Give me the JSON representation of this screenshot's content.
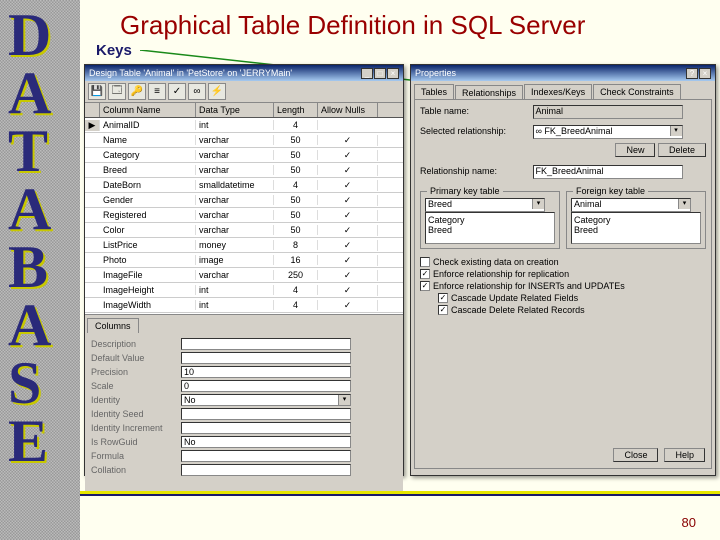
{
  "slide": {
    "title": "Graphical Table Definition in SQL Server",
    "keys_label": "Keys",
    "page_number": "80",
    "sidebar_letters": [
      "D",
      "A",
      "T",
      "A",
      "B",
      "A",
      "S",
      "E"
    ]
  },
  "design_window": {
    "title": "Design Table 'Animal' in 'PetStore' on 'JERRYMain'",
    "toolbar_icons": [
      "save-icon",
      "properties-icon",
      "key-icon",
      "index-icon",
      "check-icon",
      "relation-icon",
      "trigger-icon"
    ],
    "column_headers": [
      "",
      "Column Name",
      "Data Type",
      "Length",
      "Allow Nulls"
    ],
    "rows": [
      {
        "key": "▶",
        "name": "AnimalID",
        "type": "int",
        "len": "4",
        "nulls": ""
      },
      {
        "key": "",
        "name": "Name",
        "type": "varchar",
        "len": "50",
        "nulls": "✓"
      },
      {
        "key": "",
        "name": "Category",
        "type": "varchar",
        "len": "50",
        "nulls": "✓"
      },
      {
        "key": "",
        "name": "Breed",
        "type": "varchar",
        "len": "50",
        "nulls": "✓"
      },
      {
        "key": "",
        "name": "DateBorn",
        "type": "smalldatetime",
        "len": "4",
        "nulls": "✓"
      },
      {
        "key": "",
        "name": "Gender",
        "type": "varchar",
        "len": "50",
        "nulls": "✓"
      },
      {
        "key": "",
        "name": "Registered",
        "type": "varchar",
        "len": "50",
        "nulls": "✓"
      },
      {
        "key": "",
        "name": "Color",
        "type": "varchar",
        "len": "50",
        "nulls": "✓"
      },
      {
        "key": "",
        "name": "ListPrice",
        "type": "money",
        "len": "8",
        "nulls": "✓"
      },
      {
        "key": "",
        "name": "Photo",
        "type": "image",
        "len": "16",
        "nulls": "✓"
      },
      {
        "key": "",
        "name": "ImageFile",
        "type": "varchar",
        "len": "250",
        "nulls": "✓"
      },
      {
        "key": "",
        "name": "ImageHeight",
        "type": "int",
        "len": "4",
        "nulls": "✓"
      },
      {
        "key": "",
        "name": "ImageWidth",
        "type": "int",
        "len": "4",
        "nulls": "✓"
      }
    ],
    "tab_label": "Columns",
    "properties": [
      {
        "label": "Description",
        "value": ""
      },
      {
        "label": "Default Value",
        "value": ""
      },
      {
        "label": "Precision",
        "value": "10"
      },
      {
        "label": "Scale",
        "value": "0"
      },
      {
        "label": "Identity",
        "value": "No",
        "dropdown": true
      },
      {
        "label": "Identity Seed",
        "value": ""
      },
      {
        "label": "Identity Increment",
        "value": ""
      },
      {
        "label": "Is RowGuid",
        "value": "No"
      },
      {
        "label": "Formula",
        "value": ""
      },
      {
        "label": "Collation",
        "value": ""
      }
    ]
  },
  "prop_window": {
    "title": "Properties",
    "tabs": [
      "Tables",
      "Relationships",
      "Indexes/Keys",
      "Check Constraints"
    ],
    "table_name_label": "Table name:",
    "table_name": "Animal",
    "selected_rel_label": "Selected relationship:",
    "selected_rel": "∞ FK_BreedAnimal",
    "btn_new": "New",
    "btn_delete": "Delete",
    "rel_name_label": "Relationship name:",
    "rel_name": "FK_BreedAnimal",
    "pk_label": "Primary key table",
    "fk_label": "Foreign key table",
    "pk_table": "Breed",
    "fk_table": "Animal",
    "pk_cols": [
      "Category",
      "Breed"
    ],
    "fk_cols": [
      "Category",
      "Breed"
    ],
    "checks": [
      {
        "checked": false,
        "text": "Check existing data on creation"
      },
      {
        "checked": true,
        "text": "Enforce relationship for replication"
      },
      {
        "checked": true,
        "text": "Enforce relationship for INSERTs and UPDATEs"
      },
      {
        "checked": true,
        "text": "Cascade Update Related Fields",
        "indent": true
      },
      {
        "checked": true,
        "text": "Cascade Delete Related Records",
        "indent": true
      }
    ],
    "btn_close": "Close",
    "btn_help": "Help"
  }
}
